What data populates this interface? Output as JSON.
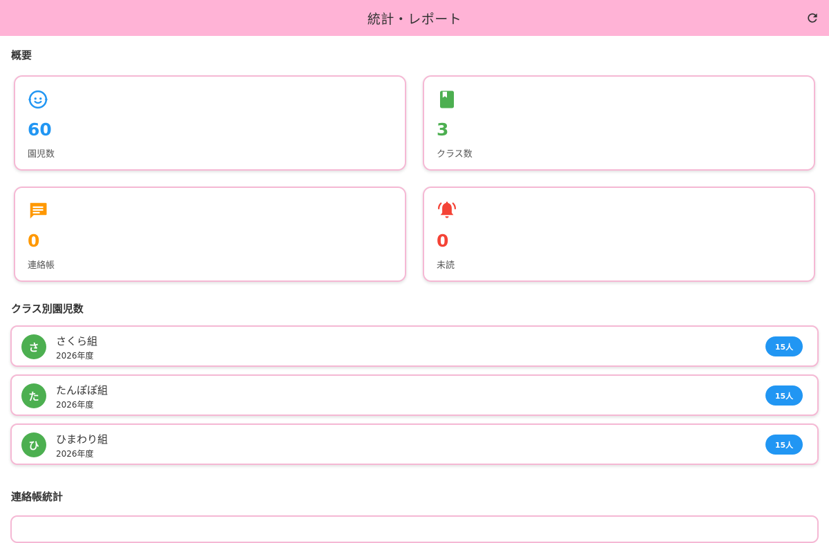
{
  "appbar": {
    "title": "統計・レポート",
    "refresh_icon": "refresh-icon",
    "background": "#ffb3d6"
  },
  "overview": {
    "title": "概要",
    "cards": [
      {
        "icon": "child-face-icon",
        "value": "60",
        "label": "園児数",
        "color": "#2196f3"
      },
      {
        "icon": "book-icon",
        "value": "3",
        "label": "クラス数",
        "color": "#4caf50"
      },
      {
        "icon": "message-icon",
        "value": "0",
        "label": "連絡帳",
        "color": "#ff9800"
      },
      {
        "icon": "bell-ringing-icon",
        "value": "0",
        "label": "未読",
        "color": "#f44336"
      }
    ]
  },
  "classes": {
    "title": "クラス別園児数",
    "items": [
      {
        "initial": "さ",
        "name": "さくら組",
        "year": "2026年度",
        "count": "15人"
      },
      {
        "initial": "た",
        "name": "たんぽぽ組",
        "year": "2026年度",
        "count": "15人"
      },
      {
        "initial": "ひ",
        "name": "ひまわり組",
        "year": "2026年度",
        "count": "15人"
      }
    ]
  },
  "notebook_stats": {
    "title": "連絡帳統計"
  }
}
